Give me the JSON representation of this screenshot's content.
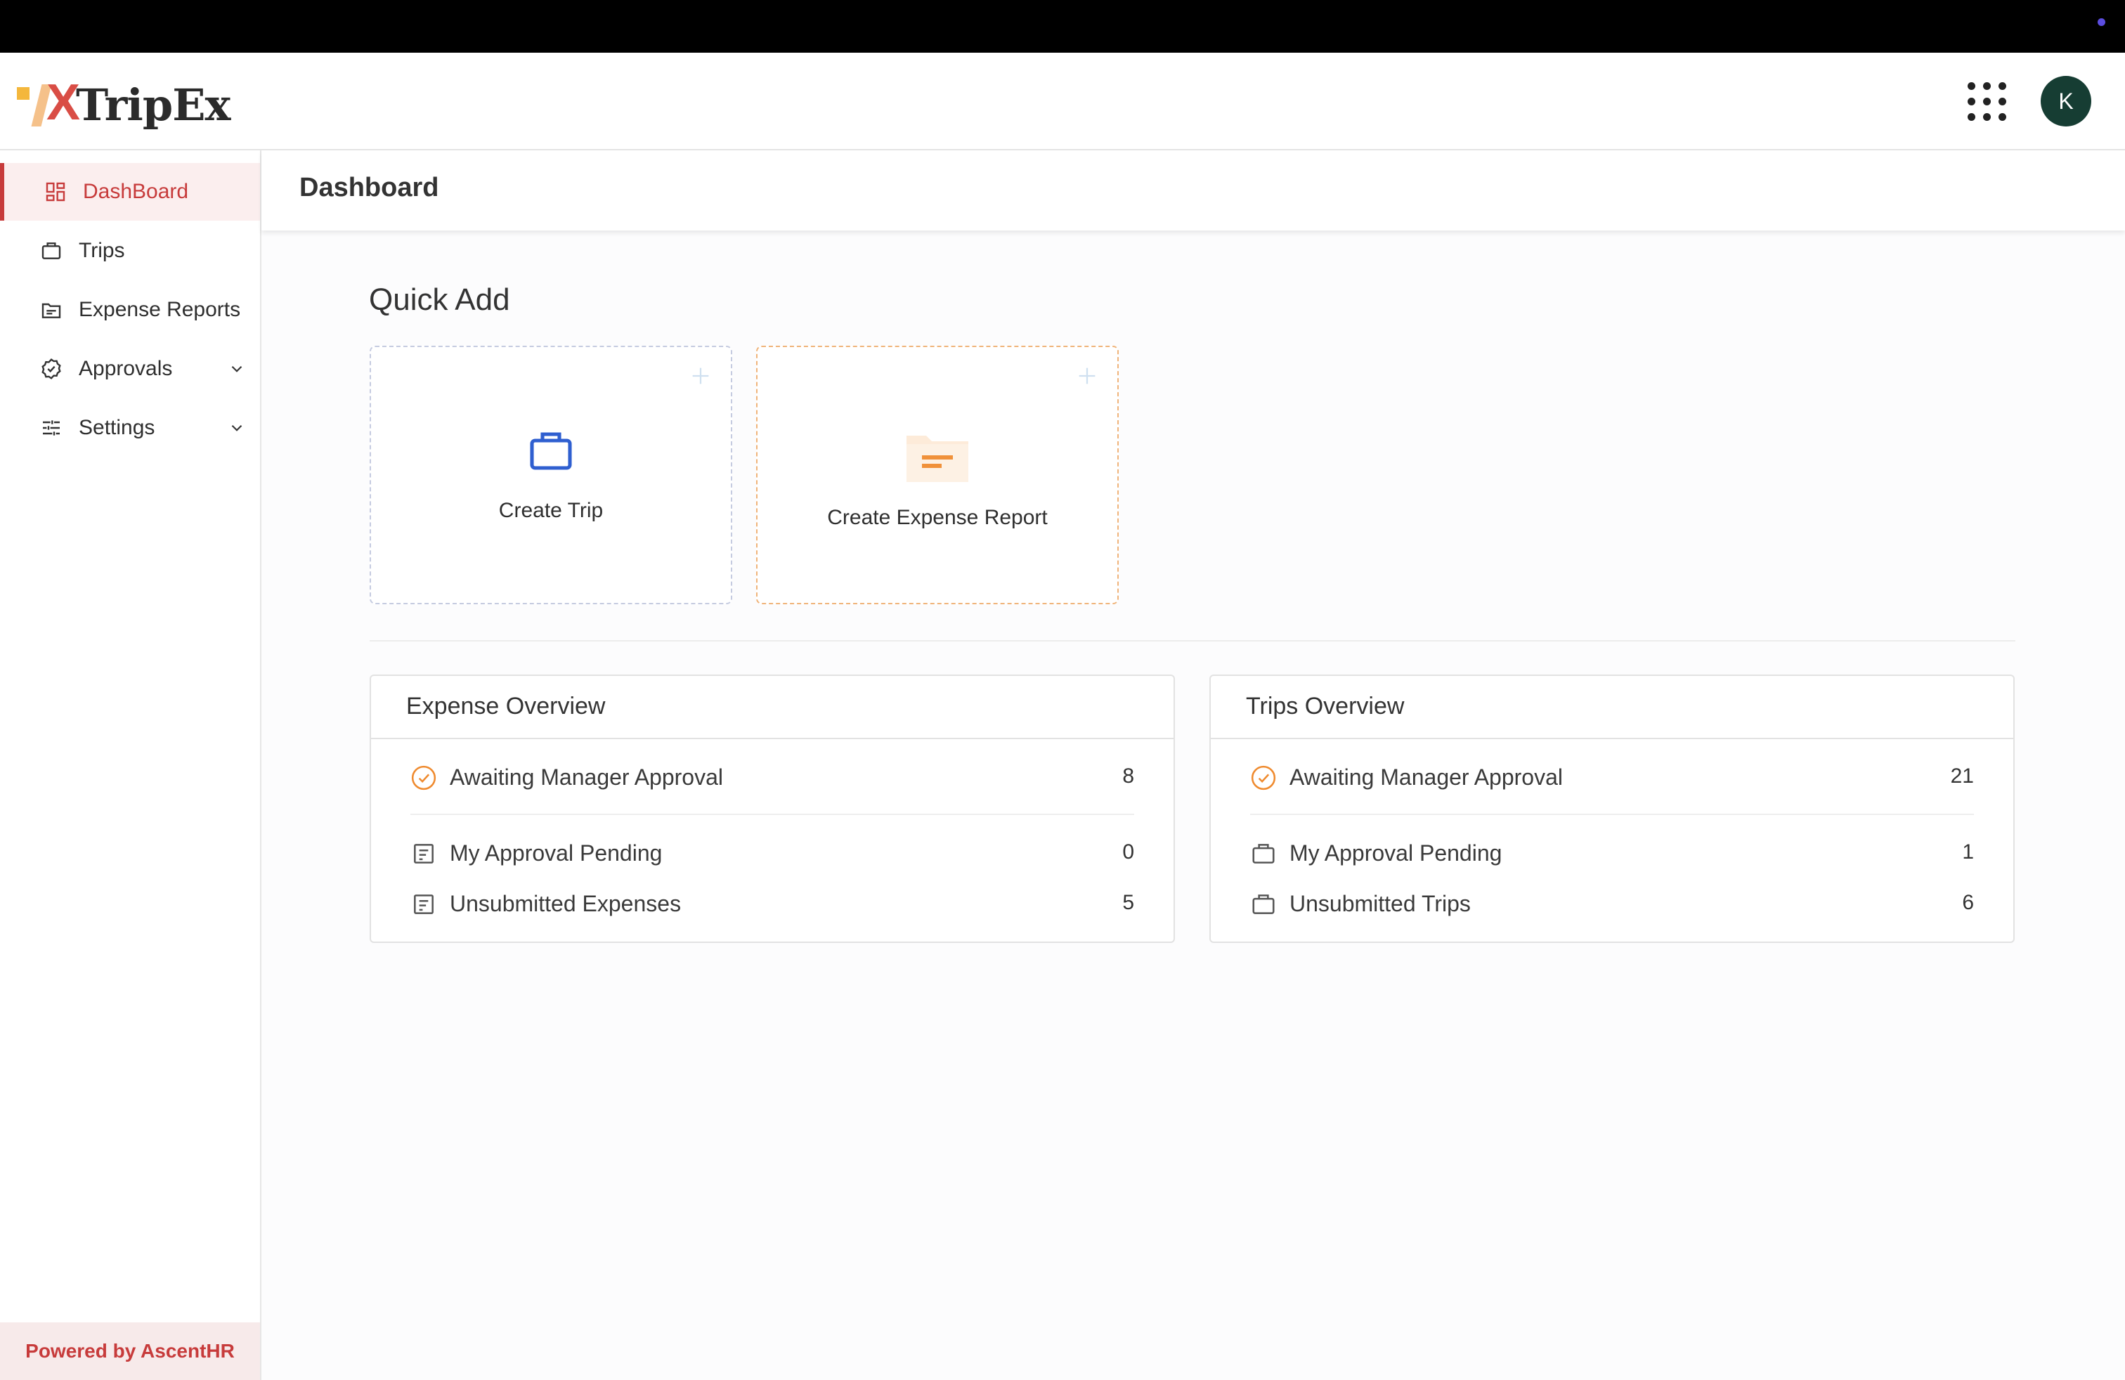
{
  "app": {
    "name": "TripEx",
    "avatar_initial": "K",
    "powered_by": "Powered by AscentHR"
  },
  "sidebar": {
    "items": [
      {
        "label": "DashBoard",
        "icon": "dashboard-icon",
        "active": true
      },
      {
        "label": "Trips",
        "icon": "briefcase-icon"
      },
      {
        "label": "Expense Reports",
        "icon": "folder-icon"
      },
      {
        "label": "Approvals",
        "icon": "badge-check-icon",
        "expandable": true
      },
      {
        "label": "Settings",
        "icon": "sliders-icon",
        "expandable": true
      }
    ]
  },
  "page": {
    "title": "Dashboard"
  },
  "quick_add": {
    "title": "Quick Add",
    "cards": [
      {
        "label": "Create Trip",
        "icon": "briefcase-icon"
      },
      {
        "label": "Create Expense Report",
        "icon": "folder-icon"
      }
    ]
  },
  "expense_overview": {
    "title": "Expense Overview",
    "rows": [
      {
        "label": "Awaiting Manager Approval",
        "value": "8",
        "icon": "check-circle-icon"
      },
      {
        "label": "My Approval Pending",
        "value": "0",
        "icon": "document-icon"
      },
      {
        "label": "Unsubmitted Expenses",
        "value": "5",
        "icon": "document-icon"
      }
    ]
  },
  "trips_overview": {
    "title": "Trips Overview",
    "rows": [
      {
        "label": "Awaiting Manager Approval",
        "value": "21",
        "icon": "check-circle-icon"
      },
      {
        "label": "My Approval Pending",
        "value": "1",
        "icon": "briefcase-icon"
      },
      {
        "label": "Unsubmitted Trips",
        "value": "6",
        "icon": "briefcase-icon"
      }
    ]
  },
  "colors": {
    "accent": "#c73b3b",
    "trip_icon": "#2f5fd0",
    "expense_icon": "#f0913a",
    "approval_icon": "#ef8a2e",
    "avatar_bg": "#163d33"
  }
}
